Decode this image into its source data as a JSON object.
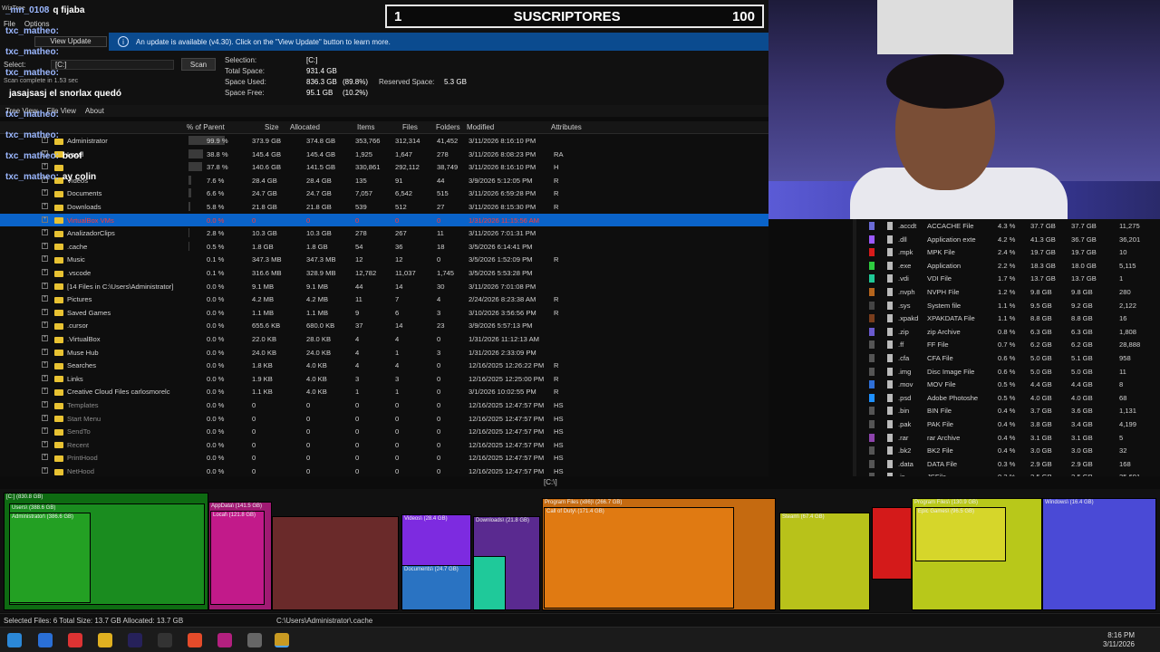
{
  "overlay": {
    "subscribers_left": "1",
    "subscribers_title": "SUSCRIPTORES",
    "subscribers_right": "100"
  },
  "app": {
    "title": "WizTree",
    "menu_top": [
      "File",
      "Options"
    ],
    "view_update_label": "View Update",
    "update_message": "An update is available (v4.30). Click on the \"View Update\" button to learn more.",
    "select_label": "Select:",
    "drive_value": "[C:]",
    "scan_label": "Scan",
    "scan_complete": "Scan complete in 1.53 sec",
    "tabs": [
      "Tree View",
      "File View",
      "About"
    ],
    "info": {
      "selection_k": "Selection:",
      "selection_v": "[C:]",
      "total_k": "Total Space:",
      "total_v": "931.4 GB",
      "used_k": "Space Used:",
      "used_v": "836.3 GB",
      "used_p": "(89.8%)",
      "reserved_k": "Reserved Space:",
      "reserved_v": "5.3 GB",
      "free_k": "Space Free:",
      "free_v": "95.1 GB",
      "free_p": "(10.2%)"
    },
    "path_label": "[C:\\]"
  },
  "chat": [
    {
      "user": "_mn_0108",
      "msg": "q fijaba"
    },
    {
      "user": "txc_matheo:",
      "msg": ""
    },
    {
      "user": "txc_matheo:",
      "msg": ""
    },
    {
      "user": "txc_matheo:",
      "msg": ""
    },
    {
      "user": "",
      "msg": "jasajsasj el snorlax quedó"
    },
    {
      "user": "txc_matheo:",
      "msg": ""
    },
    {
      "user": "txc_matheo:",
      "msg": ""
    },
    {
      "user": "txc_matheo:",
      "msg": "boof"
    },
    {
      "user": "txc_matheo:",
      "msg": "ay colin"
    }
  ],
  "tree_columns": [
    "% of Parent",
    "Size",
    "Allocated",
    "Items",
    "Files",
    "Folders",
    "Modified",
    "Attributes"
  ],
  "tree_rows": [
    {
      "name": "Administrator",
      "pct": "99.9 %",
      "size": "373.9 GB",
      "alloc": "374.8 GB",
      "items": "353,766",
      "files": "312,314",
      "folders": "41,452",
      "mod": "3/11/2026 8:16:10 PM",
      "attr": "",
      "fill": 99.9
    },
    {
      "name": "Local",
      "pct": "38.8 %",
      "size": "145.4 GB",
      "alloc": "145.4 GB",
      "items": "1,925",
      "files": "1,647",
      "folders": "278",
      "mod": "3/11/2026 8:08:23 PM",
      "attr": "RA",
      "fill": 38.8
    },
    {
      "name": "",
      "pct": "37.8 %",
      "size": "140.6 GB",
      "alloc": "141.5 GB",
      "items": "330,861",
      "files": "292,112",
      "folders": "38,749",
      "mod": "3/11/2026 8:16:10 PM",
      "attr": "H",
      "fill": 37.8
    },
    {
      "name": "Videos",
      "pct": "7.6 %",
      "size": "28.4 GB",
      "alloc": "28.4 GB",
      "items": "135",
      "files": "91",
      "folders": "44",
      "mod": "3/9/2026 5:12:05 PM",
      "attr": "R",
      "fill": 7.6
    },
    {
      "name": "Documents",
      "pct": "6.6 %",
      "size": "24.7 GB",
      "alloc": "24.7 GB",
      "items": "7,057",
      "files": "6,542",
      "folders": "515",
      "mod": "3/11/2026 6:59:28 PM",
      "attr": "R",
      "fill": 6.6
    },
    {
      "name": "Downloads",
      "pct": "5.8 %",
      "size": "21.8 GB",
      "alloc": "21.8 GB",
      "items": "539",
      "files": "512",
      "folders": "27",
      "mod": "3/11/2026 8:15:30 PM",
      "attr": "R",
      "fill": 5.8
    },
    {
      "name": "VirtualBox VMs",
      "pct": "0.0 %",
      "size": "0",
      "alloc": "0",
      "items": "0",
      "files": "0",
      "folders": "0",
      "mod": "1/31/2026 11:15:56 AM",
      "attr": "",
      "fill": 0,
      "selected": true
    },
    {
      "name": "AnalizadorClips",
      "pct": "2.8 %",
      "size": "10.3 GB",
      "alloc": "10.3 GB",
      "items": "278",
      "files": "267",
      "folders": "11",
      "mod": "3/11/2026 7:01:31 PM",
      "attr": "",
      "fill": 2.8
    },
    {
      "name": ".cache",
      "pct": "0.5 %",
      "size": "1.8 GB",
      "alloc": "1.8 GB",
      "items": "54",
      "files": "36",
      "folders": "18",
      "mod": "3/5/2026 6:14:41 PM",
      "attr": "",
      "fill": 0.5
    },
    {
      "name": "Music",
      "pct": "0.1 %",
      "size": "347.3 MB",
      "alloc": "347.3 MB",
      "items": "12",
      "files": "12",
      "folders": "0",
      "mod": "3/5/2026 1:52:09 PM",
      "attr": "R",
      "fill": 0.1
    },
    {
      "name": ".vscode",
      "pct": "0.1 %",
      "size": "316.6 MB",
      "alloc": "328.9 MB",
      "items": "12,782",
      "files": "11,037",
      "folders": "1,745",
      "mod": "3/5/2026 5:53:28 PM",
      "attr": "",
      "fill": 0.1
    },
    {
      "name": "[14 Files in C:\\Users\\Administrator]",
      "pct": "0.0 %",
      "size": "9.1 MB",
      "alloc": "9.1 MB",
      "items": "44",
      "files": "14",
      "folders": "30",
      "mod": "3/11/2026 7:01:08 PM",
      "attr": "",
      "fill": 0
    },
    {
      "name": "Pictures",
      "pct": "0.0 %",
      "size": "4.2 MB",
      "alloc": "4.2 MB",
      "items": "11",
      "files": "7",
      "folders": "4",
      "mod": "2/24/2026 8:23:38 AM",
      "attr": "R",
      "fill": 0
    },
    {
      "name": "Saved Games",
      "pct": "0.0 %",
      "size": "1.1 MB",
      "alloc": "1.1 MB",
      "items": "9",
      "files": "6",
      "folders": "3",
      "mod": "3/10/2026 3:56:56 PM",
      "attr": "R",
      "fill": 0
    },
    {
      "name": ".cursor",
      "pct": "0.0 %",
      "size": "655.6 KB",
      "alloc": "680.0 KB",
      "items": "37",
      "files": "14",
      "folders": "23",
      "mod": "3/9/2026 5:57:13 PM",
      "attr": "",
      "fill": 0
    },
    {
      "name": ".VirtualBox",
      "pct": "0.0 %",
      "size": "22.0 KB",
      "alloc": "28.0 KB",
      "items": "4",
      "files": "4",
      "folders": "0",
      "mod": "1/31/2026 11:12:13 AM",
      "attr": "",
      "fill": 0
    },
    {
      "name": "Muse Hub",
      "pct": "0.0 %",
      "size": "24.0 KB",
      "alloc": "24.0 KB",
      "items": "4",
      "files": "1",
      "folders": "3",
      "mod": "1/31/2026 2:33:09 PM",
      "attr": "",
      "fill": 0
    },
    {
      "name": "Searches",
      "pct": "0.0 %",
      "size": "1.8 KB",
      "alloc": "4.0 KB",
      "items": "4",
      "files": "4",
      "folders": "0",
      "mod": "12/16/2025 12:26:22 PM",
      "attr": "R",
      "fill": 0
    },
    {
      "name": "Links",
      "pct": "0.0 %",
      "size": "1.9 KB",
      "alloc": "4.0 KB",
      "items": "3",
      "files": "3",
      "folders": "0",
      "mod": "12/16/2025 12:25:00 PM",
      "attr": "R",
      "fill": 0
    },
    {
      "name": "Creative Cloud Files carlosmorelc",
      "pct": "0.0 %",
      "size": "1.1 KB",
      "alloc": "4.0 KB",
      "items": "1",
      "files": "1",
      "folders": "0",
      "mod": "3/1/2026 10:02:55 PM",
      "attr": "R",
      "fill": 0
    },
    {
      "name": "Templates",
      "pct": "0.0 %",
      "size": "0",
      "alloc": "0",
      "items": "0",
      "files": "0",
      "folders": "0",
      "mod": "12/16/2025 12:47:57 PM",
      "attr": "HS",
      "fill": 0,
      "hidden": true
    },
    {
      "name": "Start Menu",
      "pct": "0.0 %",
      "size": "0",
      "alloc": "0",
      "items": "0",
      "files": "0",
      "folders": "0",
      "mod": "12/16/2025 12:47:57 PM",
      "attr": "HS",
      "fill": 0,
      "hidden": true
    },
    {
      "name": "SendTo",
      "pct": "0.0 %",
      "size": "0",
      "alloc": "0",
      "items": "0",
      "files": "0",
      "folders": "0",
      "mod": "12/16/2025 12:47:57 PM",
      "attr": "HS",
      "fill": 0,
      "hidden": true
    },
    {
      "name": "Recent",
      "pct": "0.0 %",
      "size": "0",
      "alloc": "0",
      "items": "0",
      "files": "0",
      "folders": "0",
      "mod": "12/16/2025 12:47:57 PM",
      "attr": "HS",
      "fill": 0,
      "hidden": true
    },
    {
      "name": "PrintHood",
      "pct": "0.0 %",
      "size": "0",
      "alloc": "0",
      "items": "0",
      "files": "0",
      "folders": "0",
      "mod": "12/16/2025 12:47:57 PM",
      "attr": "HS",
      "fill": 0,
      "hidden": true
    },
    {
      "name": "NetHood",
      "pct": "0.0 %",
      "size": "0",
      "alloc": "0",
      "items": "0",
      "files": "0",
      "folders": "0",
      "mod": "12/16/2025 12:47:57 PM",
      "attr": "HS",
      "fill": 0,
      "hidden": true
    }
  ],
  "ext_rows": [
    {
      "ext": ".accdt",
      "type": "ACCACHE File",
      "pct": "4.3 %",
      "size": "37.7 GB",
      "alloc": "37.7 GB",
      "files": "11,275",
      "color": "#6b6bd6"
    },
    {
      "ext": ".dll",
      "type": "Application exte",
      "pct": "4.2 %",
      "size": "41.3 GB",
      "alloc": "36.7 GB",
      "files": "36,201",
      "color": "#9b59ff"
    },
    {
      "ext": ".mpk",
      "type": "MPK File",
      "pct": "2.4 %",
      "size": "19.7 GB",
      "alloc": "19.7 GB",
      "files": "10",
      "color": "#d81b1b"
    },
    {
      "ext": ".exe",
      "type": "Application",
      "pct": "2.2 %",
      "size": "18.3 GB",
      "alloc": "18.0 GB",
      "files": "5,115",
      "color": "#2ecc40"
    },
    {
      "ext": ".vdi",
      "type": "VDI File",
      "pct": "1.7 %",
      "size": "13.7 GB",
      "alloc": "13.7 GB",
      "files": "1",
      "color": "#20c997"
    },
    {
      "ext": ".nvph",
      "type": "NVPH File",
      "pct": "1.2 %",
      "size": "9.8 GB",
      "alloc": "9.8 GB",
      "files": "280",
      "color": "#b5651d"
    },
    {
      "ext": ".sys",
      "type": "System file",
      "pct": "1.1 %",
      "size": "9.5 GB",
      "alloc": "9.2 GB",
      "files": "2,122",
      "color": "#444"
    },
    {
      "ext": ".xpakd",
      "type": "XPAKDATA File",
      "pct": "1.1 %",
      "size": "8.8 GB",
      "alloc": "8.8 GB",
      "files": "16",
      "color": "#7a3e1d"
    },
    {
      "ext": ".zip",
      "type": "zip Archive",
      "pct": "0.8 %",
      "size": "6.3 GB",
      "alloc": "6.3 GB",
      "files": "1,808",
      "color": "#6a5acd"
    },
    {
      "ext": ".ff",
      "type": "FF File",
      "pct": "0.7 %",
      "size": "6.2 GB",
      "alloc": "6.2 GB",
      "files": "28,888",
      "color": "#555"
    },
    {
      "ext": ".cfa",
      "type": "CFA File",
      "pct": "0.6 %",
      "size": "5.0 GB",
      "alloc": "5.1 GB",
      "files": "958",
      "color": "#555"
    },
    {
      "ext": ".img",
      "type": "Disc Image File",
      "pct": "0.6 %",
      "size": "5.0 GB",
      "alloc": "5.0 GB",
      "files": "11",
      "color": "#555"
    },
    {
      "ext": ".mov",
      "type": "MOV File",
      "pct": "0.5 %",
      "size": "4.4 GB",
      "alloc": "4.4 GB",
      "files": "8",
      "color": "#2f6fd6"
    },
    {
      "ext": ".psd",
      "type": "Adobe Photoshe",
      "pct": "0.5 %",
      "size": "4.0 GB",
      "alloc": "4.0 GB",
      "files": "68",
      "color": "#1e90ff"
    },
    {
      "ext": ".bin",
      "type": "BIN File",
      "pct": "0.4 %",
      "size": "3.7 GB",
      "alloc": "3.6 GB",
      "files": "1,131",
      "color": "#555"
    },
    {
      "ext": ".pak",
      "type": "PAK File",
      "pct": "0.4 %",
      "size": "3.8 GB",
      "alloc": "3.4 GB",
      "files": "4,199",
      "color": "#555"
    },
    {
      "ext": ".rar",
      "type": "rar Archive",
      "pct": "0.4 %",
      "size": "3.1 GB",
      "alloc": "3.1 GB",
      "files": "5",
      "color": "#8e44ad"
    },
    {
      "ext": ".bk2",
      "type": "BK2 File",
      "pct": "0.4 %",
      "size": "3.0 GB",
      "alloc": "3.0 GB",
      "files": "32",
      "color": "#555"
    },
    {
      "ext": ".data",
      "type": "DATA File",
      "pct": "0.3 %",
      "size": "2.9 GB",
      "alloc": "2.9 GB",
      "files": "168",
      "color": "#555"
    },
    {
      "ext": ".js",
      "type": "JSFile",
      "pct": "0.3 %",
      "size": "2.5 GB",
      "alloc": "2.5 GB",
      "files": "35,691",
      "color": "#555"
    }
  ],
  "treemap_labels": [
    "[C:] (830.8 GB)",
    "Users\\ (388.6 GB)",
    "Administrator\\ (386.6 GB)",
    "AppData\\ (141.5 GB)",
    "Local\\ (121.8 GB)",
    "Videos\\ (28.4 GB)",
    "Downloads\\ (21.8 GB)",
    "Documents\\ (24.7 GB)",
    "Program Files (x86)\\ (266.7 GB)",
    "Call of Duty\\ (171.4 GB)",
    "Steam\\ (67.4 GB)",
    "Program Files\\ (130.9 GB)",
    "Epic Games\\ (96.5 GB)",
    "Windows\\ (16.4 GB)"
  ],
  "status": {
    "selected": "Selected Files: 6  Total Size: 13.7 GB  Allocated: 13.7 GB",
    "path": "C:\\Users\\Administrator\\.cache"
  },
  "clock": {
    "time": "8:16 PM",
    "date": "3/11/2026"
  }
}
